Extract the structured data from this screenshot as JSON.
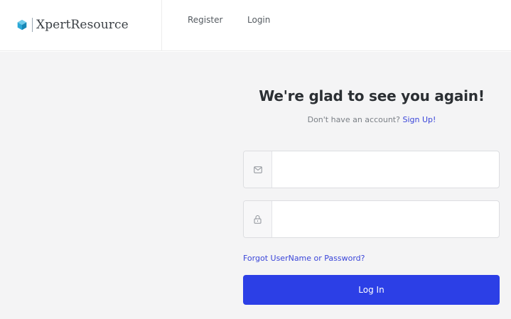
{
  "header": {
    "brand_name": "XpertResource",
    "brand_icon": "cube-icon",
    "nav": {
      "register_label": "Register",
      "login_label": "Login"
    }
  },
  "login_form": {
    "heading": "We're glad to see you again!",
    "signup_prompt": "Don't have an account?",
    "signup_link": "Sign Up!",
    "email_field": {
      "icon": "envelope-icon",
      "value": "",
      "placeholder": ""
    },
    "password_field": {
      "icon": "lock-icon",
      "value": "",
      "placeholder": ""
    },
    "forgot_link": "Forgot UserName or Password?",
    "submit_label": "Log In"
  },
  "colors": {
    "accent": "#2c3fe6",
    "link": "#3a45d9",
    "brand_icon": "#2aa7d6",
    "background": "#f4f4f5"
  }
}
